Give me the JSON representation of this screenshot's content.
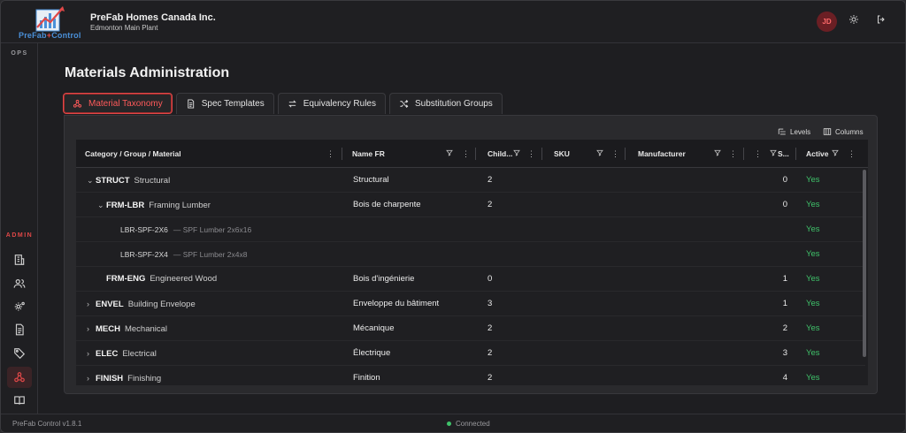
{
  "header": {
    "logo_text_a": "PreFab",
    "logo_text_b": "Control",
    "company": "PreFab Homes Canada Inc.",
    "plant": "Edmonton Main Plant",
    "avatar_initials": "JD"
  },
  "sidebar": {
    "section_ops": "OPS",
    "section_admin": "ADMIN",
    "admin_items": [
      {
        "icon": "building-icon"
      },
      {
        "icon": "users-icon"
      },
      {
        "icon": "gears-icon"
      },
      {
        "icon": "document-icon"
      },
      {
        "icon": "tag-icon"
      },
      {
        "icon": "taxonomy-icon",
        "active": true
      },
      {
        "icon": "book-icon"
      }
    ]
  },
  "page": {
    "title": "Materials Administration"
  },
  "tabs": [
    {
      "label": "Material Taxonomy",
      "icon": "taxonomy-icon",
      "active": true
    },
    {
      "label": "Spec Templates",
      "icon": "document-icon"
    },
    {
      "label": "Equivalency Rules",
      "icon": "swap-arrows-icon"
    },
    {
      "label": "Substitution Groups",
      "icon": "shuffle-icon"
    }
  ],
  "toolbar": {
    "levels_label": "Levels",
    "columns_label": "Columns"
  },
  "grid": {
    "columns": {
      "category": "Category / Group / Material",
      "name_fr": "Name FR",
      "children": "Child...",
      "sku": "SKU",
      "manufacturer": "Manufacturer",
      "sort": "S...",
      "active": "Active"
    },
    "rows": [
      {
        "level": 0,
        "expander": "⌄",
        "code": "STRUCT",
        "name": "Structural",
        "name_fr": "Structural",
        "children": "2",
        "sort": "0",
        "active": "Yes"
      },
      {
        "level": 1,
        "expander": "⌄",
        "code": "FRM-LBR",
        "name": "Framing Lumber",
        "name_fr": "Bois de charpente",
        "children": "2",
        "sort": "0",
        "active": "Yes"
      },
      {
        "level": 2,
        "code": "LBR-SPF-2X6",
        "name": "— SPF Lumber 2x6x16",
        "name_fr": "",
        "children": "",
        "sort": "",
        "active": "Yes"
      },
      {
        "level": 2,
        "code": "LBR-SPF-2X4",
        "name": "— SPF Lumber 2x4x8",
        "name_fr": "",
        "children": "",
        "sort": "",
        "active": "Yes"
      },
      {
        "level": 1,
        "expander": "",
        "code": "FRM-ENG",
        "name": "Engineered Wood",
        "name_fr": "Bois d'ingénierie",
        "children": "0",
        "sort": "1",
        "active": "Yes"
      },
      {
        "level": 0,
        "expander": "›",
        "code": "ENVEL",
        "name": "Building Envelope",
        "name_fr": "Enveloppe du bâtiment",
        "children": "3",
        "sort": "1",
        "active": "Yes"
      },
      {
        "level": 0,
        "expander": "›",
        "code": "MECH",
        "name": "Mechanical",
        "name_fr": "Mécanique",
        "children": "2",
        "sort": "2",
        "active": "Yes"
      },
      {
        "level": 0,
        "expander": "›",
        "code": "ELEC",
        "name": "Electrical",
        "name_fr": "Électrique",
        "children": "2",
        "sort": "3",
        "active": "Yes"
      },
      {
        "level": 0,
        "expander": "›",
        "code": "FINISH",
        "name": "Finishing",
        "name_fr": "Finition",
        "children": "2",
        "sort": "4",
        "active": "Yes"
      }
    ]
  },
  "footer": {
    "version": "PreFab Control v1.8.1",
    "status": "Connected"
  },
  "colors": {
    "accent": "#e04848",
    "active_yes": "#3fc26a",
    "background": "#1e1e21"
  }
}
